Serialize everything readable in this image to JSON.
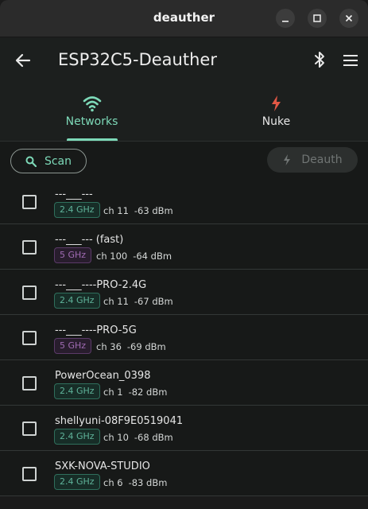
{
  "window": {
    "title": "deauther"
  },
  "appbar": {
    "title": "ESP32C5-Deauther"
  },
  "tabs": [
    {
      "label": "Networks",
      "icon": "wifi-icon",
      "active": true
    },
    {
      "label": "Nuke",
      "icon": "bolt-icon",
      "active": false
    }
  ],
  "actions": {
    "scan_label": "Scan",
    "deauth_label": "Deauth"
  },
  "colors": {
    "accent": "#7dd9b8",
    "nuke": "#e25745",
    "band24": "#5fb39a",
    "band5": "#a06bb3",
    "background": "#171918"
  },
  "networks": [
    {
      "ssid": "---___---",
      "band": "2.4 GHz",
      "channel": "ch 11",
      "rssi": "-63 dBm"
    },
    {
      "ssid": "---___--- (fast)",
      "band": "5 GHz",
      "channel": "ch 100",
      "rssi": "-64 dBm"
    },
    {
      "ssid": "---___----PRO-2.4G",
      "band": "2.4 GHz",
      "channel": "ch 11",
      "rssi": "-67 dBm"
    },
    {
      "ssid": "---___----PRO-5G",
      "band": "5 GHz",
      "channel": "ch 36",
      "rssi": "-69 dBm"
    },
    {
      "ssid": "PowerOcean_0398",
      "band": "2.4 GHz",
      "channel": "ch 1",
      "rssi": "-82 dBm"
    },
    {
      "ssid": "shellyuni-08F9E0519041",
      "band": "2.4 GHz",
      "channel": "ch 10",
      "rssi": "-68 dBm"
    },
    {
      "ssid": "SXK-NOVA-STUDIO",
      "band": "2.4 GHz",
      "channel": "ch 6",
      "rssi": "-83 dBm"
    }
  ]
}
